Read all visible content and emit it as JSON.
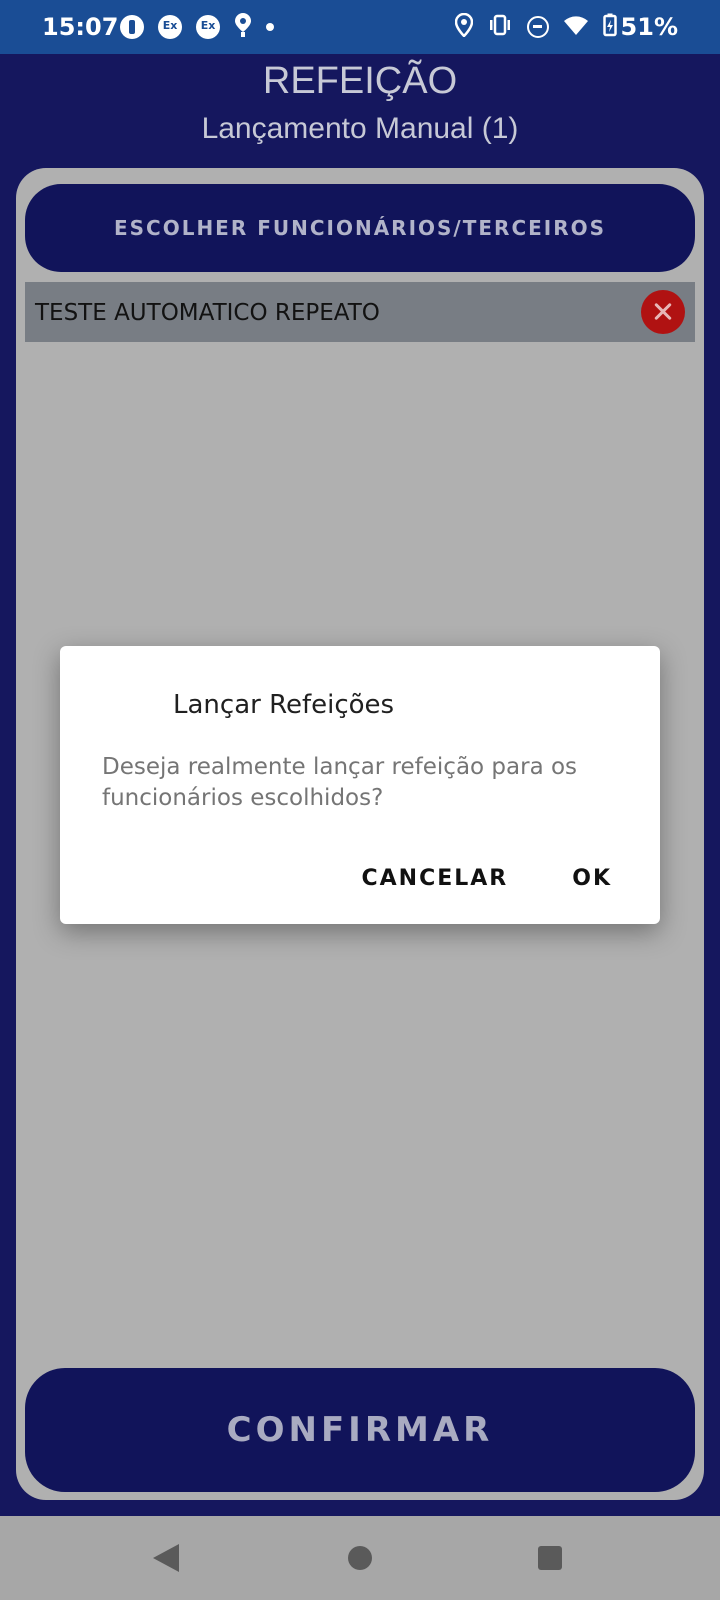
{
  "status_bar": {
    "time": "15:07",
    "battery": "51%",
    "left_icons": [
      "p1-icon",
      "exchange-icon",
      "exchange-icon",
      "maps-pin-icon",
      "dot-icon"
    ],
    "right_icons": [
      "location-icon",
      "vibrate-icon",
      "do-not-disturb-icon",
      "wifi-icon",
      "battery-charging-icon"
    ]
  },
  "header": {
    "title": "REFEIÇÃO",
    "subtitle": "Lançamento Manual (1)"
  },
  "main": {
    "choose_button": "ESCOLHER FUNCIONÁRIOS/TERCEIROS",
    "employees": [
      {
        "name": "TESTE AUTOMATICO REPEATO"
      }
    ],
    "confirm_button": "CONFIRMAR"
  },
  "dialog": {
    "title": "Lançar Refeições",
    "message": "Deseja realmente lançar refeição para os funcionários escolhidos?",
    "cancel": "CANCELAR",
    "ok": "OK"
  },
  "colors": {
    "status_bar": "#1a4d95",
    "app_background": "#15175e",
    "button_background": "#11145a",
    "card_background": "#b0b0b0",
    "remove_red": "#b01212"
  }
}
